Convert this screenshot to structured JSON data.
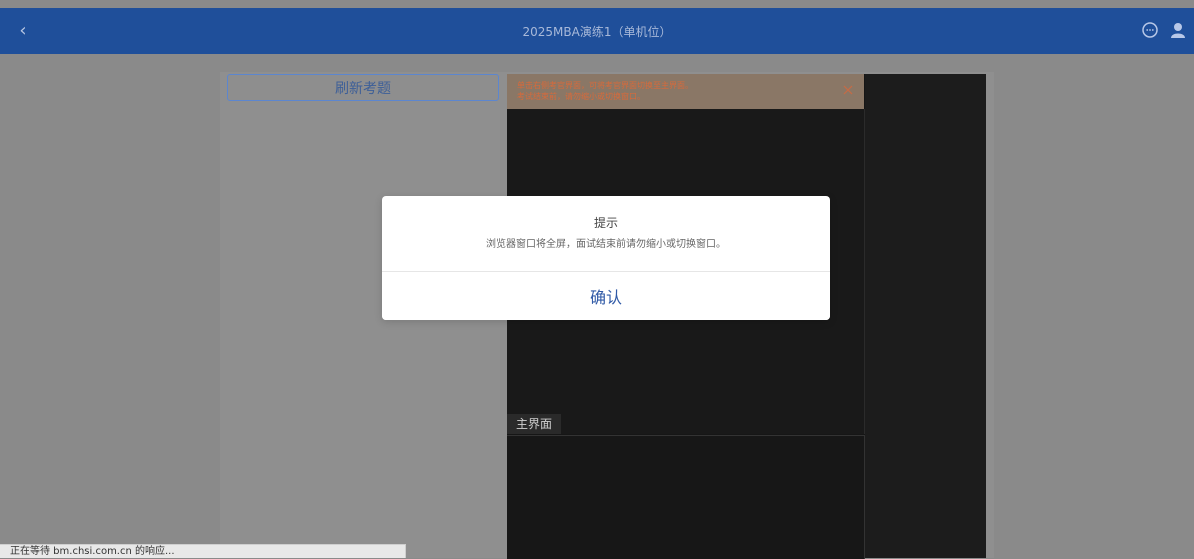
{
  "topbar": {
    "back_glyph": "‹",
    "title": "2025MBA演练1（单机位）"
  },
  "left_panel": {
    "refresh_label": "刷新考题"
  },
  "video": {
    "warning_lines": [
      "单击右侧考官界面，可将考官界面切换至主界面。",
      "考试结束前，请勿缩小或切换窗口。"
    ],
    "main_label": "主界面"
  },
  "modal": {
    "title": "提示",
    "message": "浏览器窗口将全屏，面试结束前请勿缩小或切换窗口。",
    "confirm_label": "确认"
  },
  "status_bar": {
    "text": "正在等待 bm.chsi.com.cn 的响应..."
  },
  "icons": {
    "back": "chevron-left-icon",
    "chat": "chat-bubble-icon",
    "user": "user-icon",
    "close": "close-icon"
  },
  "colors": {
    "header": "#1f4f9a",
    "accent": "#2f59a6",
    "warning_text": "#d86a3a"
  }
}
